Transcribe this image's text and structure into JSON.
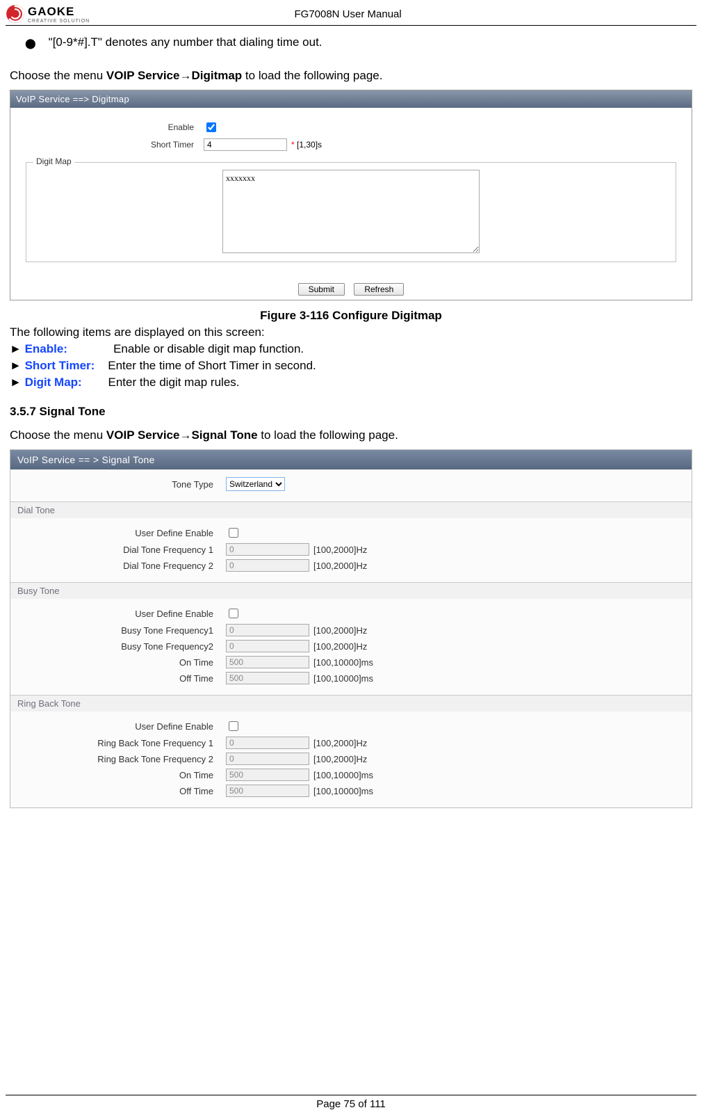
{
  "header": {
    "logo_brand": "GAOKE",
    "logo_tag": "CREATIVE SOLUTION",
    "manual_title": "FG7008N User Manual"
  },
  "intro": {
    "bullet": "\"[0-9*#].T\" denotes any number that dialing time out.",
    "choose_prefix": "Choose the menu ",
    "nav_1": "VOIP Service",
    "arrow": "→",
    "nav_2": "Digitmap",
    "choose_suffix": " to load the following page."
  },
  "digitmap_panel": {
    "title": "VoIP Service ==> Digitmap",
    "enable_label": "Enable",
    "enable_checked": true,
    "short_timer_label": "Short Timer",
    "short_timer_value": "4",
    "short_timer_hint": "[1,30]s",
    "fieldset_legend": "Digit Map",
    "textarea_value": "xxxxxxx",
    "submit_label": "Submit",
    "refresh_label": "Refresh"
  },
  "fig_caption": "Figure 3-116 Configure Digitmap",
  "desc_intro": "The following items are displayed on this screen:",
  "defs": [
    {
      "term": "Enable:",
      "text": "Enable or disable digit map function."
    },
    {
      "term": "Short Timer:",
      "text": "Enter the time of Short Timer in second."
    },
    {
      "term": "Digit Map:",
      "text": "Enter the digit map rules."
    }
  ],
  "section_heading": "3.5.7    Signal Tone",
  "signal_intro": {
    "choose_prefix": "Choose the menu ",
    "nav_1": "VOIP Service",
    "arrow": "→",
    "nav_2": "Signal Tone",
    "choose_suffix": " to load the following page."
  },
  "signal_panel": {
    "title": "VoIP Service == > Signal Tone",
    "tone_type_label": "Tone Type",
    "tone_type_value": "Switzerland",
    "sections": {
      "dial": {
        "header": "Dial Tone",
        "rows": [
          {
            "label": "User Define Enable",
            "kind": "check",
            "checked": false
          },
          {
            "label": "Dial Tone Frequency 1",
            "kind": "num",
            "value": "0",
            "hint": "[100,2000]Hz"
          },
          {
            "label": "Dial Tone Frequency 2",
            "kind": "num",
            "value": "0",
            "hint": "[100,2000]Hz"
          }
        ]
      },
      "busy": {
        "header": "Busy Tone",
        "rows": [
          {
            "label": "User Define Enable",
            "kind": "check",
            "checked": false
          },
          {
            "label": "Busy Tone Frequency1",
            "kind": "num",
            "value": "0",
            "hint": "[100,2000]Hz"
          },
          {
            "label": "Busy Tone Frequency2",
            "kind": "num",
            "value": "0",
            "hint": "[100,2000]Hz"
          },
          {
            "label": "On Time",
            "kind": "num",
            "value": "500",
            "hint": "[100,10000]ms"
          },
          {
            "label": "Off Time",
            "kind": "num",
            "value": "500",
            "hint": "[100,10000]ms"
          }
        ]
      },
      "ringback": {
        "header": "Ring Back Tone",
        "rows": [
          {
            "label": "User Define Enable",
            "kind": "check",
            "checked": false
          },
          {
            "label": "Ring Back Tone Frequency 1",
            "kind": "num",
            "value": "0",
            "hint": "[100,2000]Hz"
          },
          {
            "label": "Ring Back Tone Frequency 2",
            "kind": "num",
            "value": "0",
            "hint": "[100,2000]Hz"
          },
          {
            "label": "On Time",
            "kind": "num",
            "value": "500",
            "hint": "[100,10000]ms"
          },
          {
            "label": "Off Time",
            "kind": "num",
            "value": "500",
            "hint": "[100,10000]ms"
          }
        ]
      }
    }
  },
  "footer": "Page 75 of 111"
}
